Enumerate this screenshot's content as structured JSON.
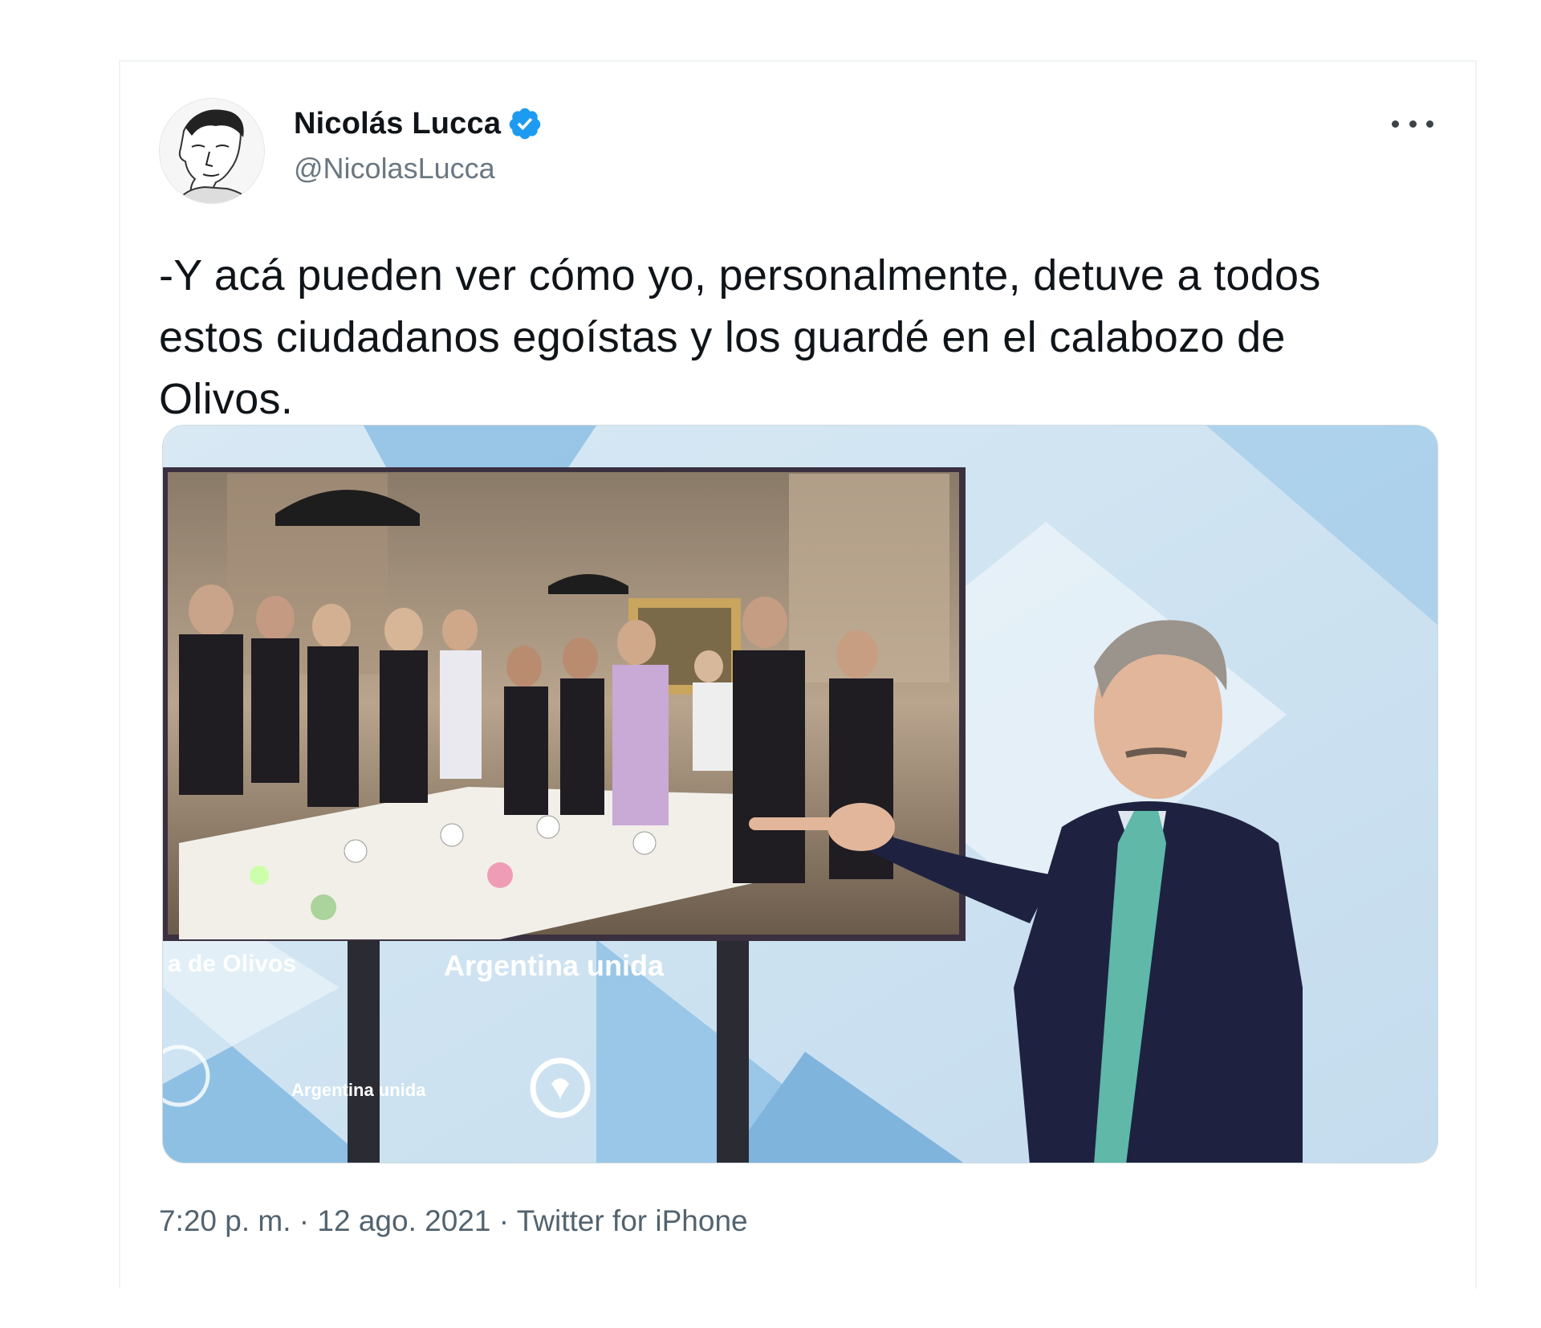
{
  "tweet": {
    "author_name": "Nicolás Lucca",
    "author_handle": "@NicolasLucca",
    "verified": true,
    "text": "-Y acá pueden ver cómo yo, personalmente, detuve a todos estos ciudadanos egoístas y los guardé en el calabozo de Olivos.",
    "time": "7:20 p. m.",
    "date": "12 ago. 2021",
    "source": "Twitter for iPhone",
    "separator": " · "
  },
  "media": {
    "backdrop_text_left": "a de Olivos",
    "backdrop_text_center": "Argentina unida",
    "backdrop_text_small": "Argentina unida"
  },
  "colors": {
    "verified_blue": "#1d9bf0",
    "backdrop_light": "#cfe4f2",
    "backdrop_blue": "#8fc0e3"
  },
  "icons": {
    "verified": "verified-badge-icon",
    "more": "more-options-icon"
  }
}
